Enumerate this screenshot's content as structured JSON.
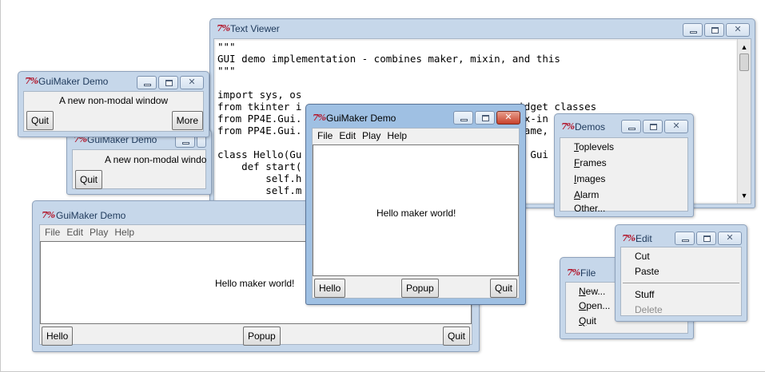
{
  "tk_logo": "7%",
  "window_controls": {
    "minimize": "minimize-icon",
    "maximize": "maximize-icon",
    "close": "close-icon"
  },
  "text_viewer": {
    "title": "Text Viewer",
    "lines": [
      "\"\"\"",
      "GUI demo implementation - combines maker, mixin, and this",
      "\"\"\"",
      "",
      "import sys, os",
      "from tkinter i                                    idget classes",
      "from PP4E.Gui.                                    ix-in       etc.",
      "from PP4E.Gui.                                    rame,       lder",
      "",
      "class Hello(Gu                                    r Gui",
      "    def start(",
      "        self.h",
      "        self.m"
    ]
  },
  "guimaker_small_1": {
    "title": "GuiMaker Demo",
    "message": "A new non-modal window",
    "quit_label": "Quit",
    "more_label": "More"
  },
  "guimaker_small_2": {
    "title": "GuiMaker Demo",
    "message": "A new non-modal windo",
    "quit_label": "Quit"
  },
  "guimaker_large": {
    "title": "GuiMaker Demo",
    "menus": [
      "File",
      "Edit",
      "Play",
      "Help"
    ],
    "message": "Hello maker world!",
    "hello_label": "Hello",
    "popup_label": "Popup",
    "quit_label": "Quit"
  },
  "guimaker_active": {
    "title": "GuiMaker Demo",
    "menus": [
      "File",
      "Edit",
      "Play",
      "Help"
    ],
    "message": "Hello maker world!",
    "hello_label": "Hello",
    "popup_label": "Popup",
    "quit_label": "Quit"
  },
  "demos_menu": {
    "title": "Demos",
    "items": [
      "Toplevels",
      "Frames",
      "Images",
      "Alarm",
      "Other..."
    ]
  },
  "file_menu": {
    "title": "File",
    "items": [
      "New...",
      "Open...",
      "Quit"
    ]
  },
  "edit_menu": {
    "title": "Edit",
    "items": [
      "Cut",
      "Paste",
      "Stuff",
      "Delete"
    ],
    "disabled": [
      "Delete"
    ]
  }
}
